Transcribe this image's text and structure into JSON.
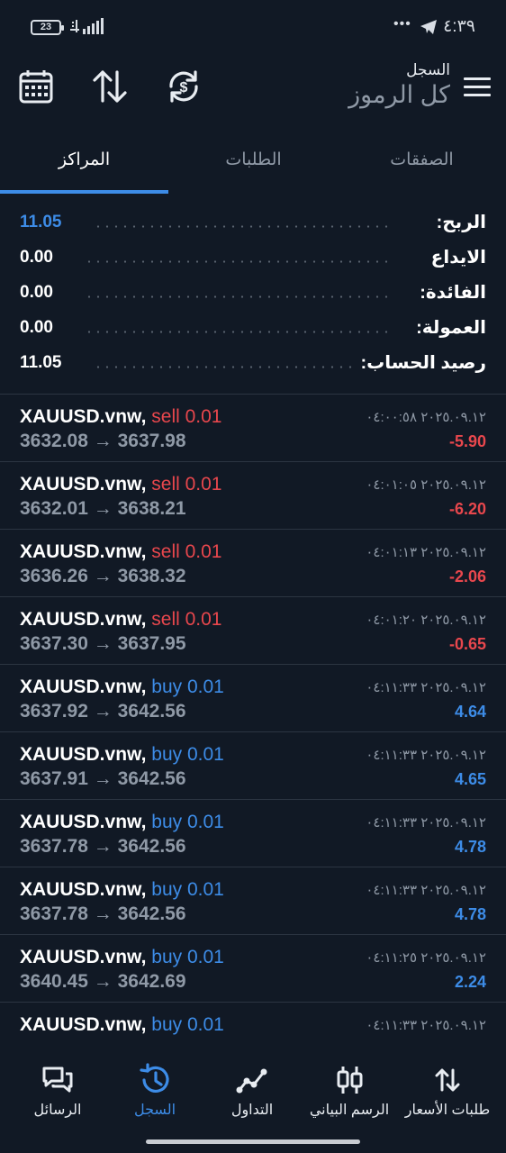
{
  "status_bar": {
    "battery": "23",
    "time": "٤:٣٩",
    "dots": "•••"
  },
  "header": {
    "title": "السجل",
    "subtitle": "كل الرموز"
  },
  "tabs": [
    {
      "label": "الصفقات",
      "active": false
    },
    {
      "label": "الطلبات",
      "active": false
    },
    {
      "label": "المراكز",
      "active": true
    }
  ],
  "summary": [
    {
      "label": "الربح:",
      "value": "11.05"
    },
    {
      "label": "الايداع",
      "value": "0.00"
    },
    {
      "label": "الفائدة:",
      "value": "0.00"
    },
    {
      "label": "العمولة:",
      "value": "0.00"
    },
    {
      "label": "رصيد الحساب:",
      "value": "11.05"
    }
  ],
  "deals": [
    {
      "symbol": "XAUUSD.vnw,",
      "side": "sell 0.01",
      "open": "3632.08",
      "close": "3637.98",
      "time": "٢٠٢٥.٠٩.١٢ ٠٤:٠٠:٥٨",
      "profit": "-5.90"
    },
    {
      "symbol": "XAUUSD.vnw,",
      "side": "sell 0.01",
      "open": "3632.01",
      "close": "3638.21",
      "time": "٢٠٢٥.٠٩.١٢ ٠٤:٠١:٠٥",
      "profit": "-6.20"
    },
    {
      "symbol": "XAUUSD.vnw,",
      "side": "sell 0.01",
      "open": "3636.26",
      "close": "3638.32",
      "time": "٢٠٢٥.٠٩.١٢ ٠٤:٠١:١٣",
      "profit": "-2.06"
    },
    {
      "symbol": "XAUUSD.vnw,",
      "side": "sell 0.01",
      "open": "3637.30",
      "close": "3637.95",
      "time": "٢٠٢٥.٠٩.١٢ ٠٤:٠١:٢٠",
      "profit": "-0.65"
    },
    {
      "symbol": "XAUUSD.vnw,",
      "side": "buy 0.01",
      "open": "3637.92",
      "close": "3642.56",
      "time": "٢٠٢٥.٠٩.١٢ ٠٤:١١:٣٣",
      "profit": "4.64"
    },
    {
      "symbol": "XAUUSD.vnw,",
      "side": "buy 0.01",
      "open": "3637.91",
      "close": "3642.56",
      "time": "٢٠٢٥.٠٩.١٢ ٠٤:١١:٣٣",
      "profit": "4.65"
    },
    {
      "symbol": "XAUUSD.vnw,",
      "side": "buy 0.01",
      "open": "3637.78",
      "close": "3642.56",
      "time": "٢٠٢٥.٠٩.١٢ ٠٤:١١:٣٣",
      "profit": "4.78"
    },
    {
      "symbol": "XAUUSD.vnw,",
      "side": "buy 0.01",
      "open": "3637.78",
      "close": "3642.56",
      "time": "٢٠٢٥.٠٩.١٢ ٠٤:١١:٣٣",
      "profit": "4.78"
    },
    {
      "symbol": "XAUUSD.vnw,",
      "side": "buy 0.01",
      "open": "3640.45",
      "close": "3642.69",
      "time": "٢٠٢٥.٠٩.١٢ ٠٤:١١:٢٥",
      "profit": "2.24"
    },
    {
      "symbol": "XAUUSD.vnw,",
      "side": "buy 0.01",
      "open": "",
      "close": "",
      "time": "٢٠٢٥.٠٩.١٢ ٠٤:١١:٣٣",
      "profit": ""
    }
  ],
  "arrow": "→",
  "bottom_nav": [
    {
      "label": "الرسائل",
      "icon": "messages-icon",
      "active": false
    },
    {
      "label": "السجل",
      "icon": "history-icon",
      "active": true
    },
    {
      "label": "التداول",
      "icon": "trade-icon",
      "active": false
    },
    {
      "label": "الرسم البياني",
      "icon": "chart-icon",
      "active": false
    },
    {
      "label": "طلبات الأسعار",
      "icon": "quotes-icon",
      "active": false
    }
  ],
  "colors": {
    "background": "#111925",
    "accent": "#3d8ce7",
    "sell": "#e8474d",
    "muted": "#8f99a6"
  }
}
